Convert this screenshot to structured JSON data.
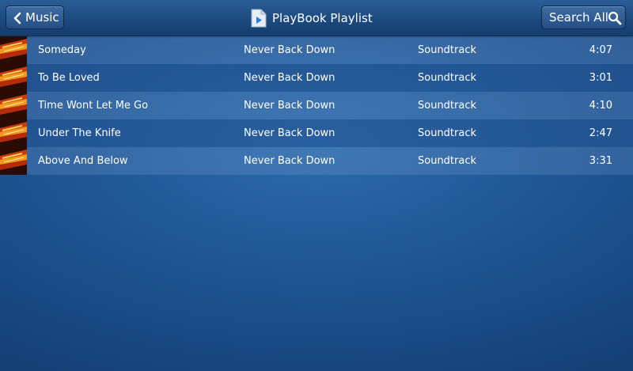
{
  "header": {
    "back_label": "Music",
    "title": "PlayBook Playlist",
    "search_label": "Search All"
  },
  "tracks": [
    {
      "title": "Someday",
      "album": "Never Back Down",
      "genre": "Soundtrack",
      "duration": "4:07"
    },
    {
      "title": "To Be Loved",
      "album": "Never Back Down",
      "genre": "Soundtrack",
      "duration": "3:01"
    },
    {
      "title": "Time Wont Let Me Go",
      "album": "Never Back Down",
      "genre": "Soundtrack",
      "duration": "4:10"
    },
    {
      "title": "Under The Knife",
      "album": "Never Back Down",
      "genre": "Soundtrack",
      "duration": "2:47"
    },
    {
      "title": "Above And Below",
      "album": "Never Back Down",
      "genre": "Soundtrack",
      "duration": "3:31"
    }
  ],
  "icons": {
    "back": "chevron-left-icon",
    "document": "document-play-icon",
    "search": "search-icon",
    "album_art": "album-art-icon"
  },
  "colors": {
    "background": "#1f5592",
    "header": "#1c4a7f",
    "row_light": "#4a7bb8",
    "row_dark": "#1f5591",
    "text": "#ffffff"
  }
}
